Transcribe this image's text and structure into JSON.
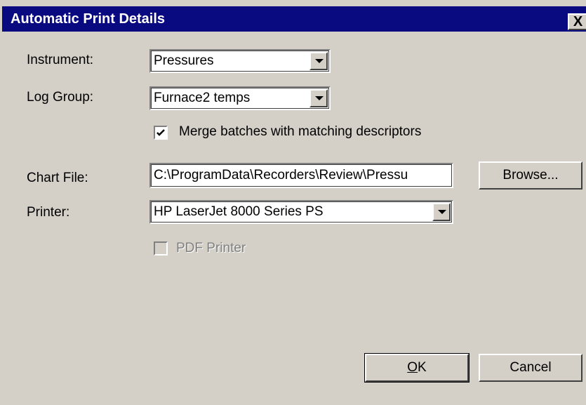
{
  "window": {
    "title": "Automatic Print Details",
    "close_label": "X"
  },
  "instrument": {
    "label": "Instrument:",
    "value": "Pressures"
  },
  "log_group": {
    "label": "Log Group:",
    "value": "Furnace2 temps"
  },
  "merge": {
    "label": "Merge batches with matching descriptors",
    "checked": true
  },
  "chart_file": {
    "label": "Chart File:",
    "value": "C:\\ProgramData\\Recorders\\Review\\Pressu"
  },
  "browse": {
    "label": "Browse..."
  },
  "printer": {
    "label": "Printer:",
    "value": "HP LaserJet 8000 Series PS"
  },
  "pdf_printer": {
    "label": "PDF Printer",
    "checked": false,
    "enabled": false
  },
  "buttons": {
    "ok": "OK",
    "cancel": "Cancel"
  },
  "colors": {
    "titlebar": "#0a0a80",
    "face": "#d4d0c8"
  }
}
